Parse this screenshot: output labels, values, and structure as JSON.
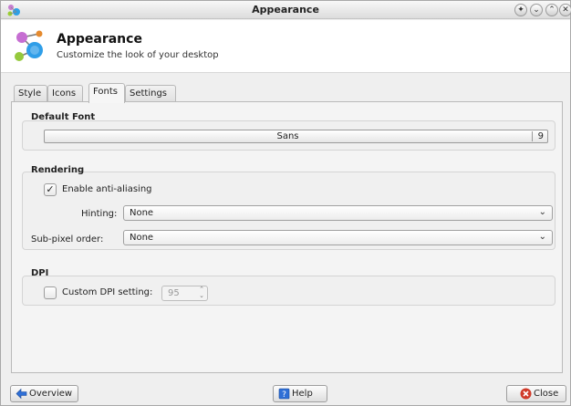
{
  "window": {
    "title": "Appearance",
    "controls": [
      "help-icon",
      "minimize-icon",
      "maximize-icon",
      "close-icon"
    ]
  },
  "header": {
    "title": "Appearance",
    "subtitle": "Customize the look of your desktop"
  },
  "tabs": [
    {
      "label": "Style",
      "active": false
    },
    {
      "label": "Icons",
      "active": false
    },
    {
      "label": "Fonts",
      "active": true
    },
    {
      "label": "Settings",
      "active": false
    }
  ],
  "fonts": {
    "default_font": {
      "title": "Default Font",
      "name": "Sans",
      "size": "9"
    },
    "rendering": {
      "title": "Rendering",
      "antialias": {
        "label": "Enable anti-aliasing",
        "checked": true
      },
      "hinting": {
        "label": "Hinting:",
        "value": "None"
      },
      "subpixel": {
        "label": "Sub-pixel order:",
        "value": "None"
      }
    },
    "dpi": {
      "title": "DPI",
      "custom": {
        "label": "Custom DPI setting:",
        "checked": false
      },
      "value": "95"
    }
  },
  "buttons": {
    "overview": "Overview",
    "help": "Help",
    "close": "Close"
  },
  "colors": {
    "accent_blue": "#2f6fd6",
    "close_red": "#d03a2a"
  }
}
